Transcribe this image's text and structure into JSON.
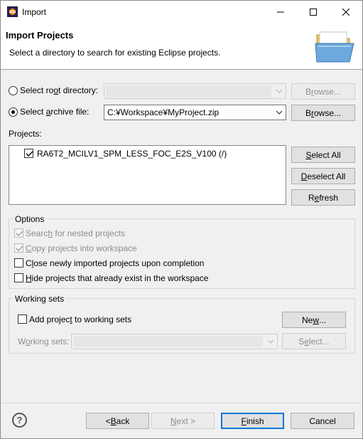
{
  "window": {
    "title": "Import"
  },
  "header": {
    "title": "Import Projects",
    "description": "Select a directory to search for existing Eclipse projects."
  },
  "source": {
    "root_dir": {
      "label_pre": "Select ro",
      "label_u": "o",
      "label_post": "t directory:",
      "value": "",
      "browse_pre": "B",
      "browse_u": "r",
      "browse_post": "owse...",
      "selected": false
    },
    "archive": {
      "label_pre": "Select ",
      "label_u": "a",
      "label_post": "rchive file:",
      "value": "C:¥Workspace¥MyProject.zip",
      "browse_pre": "B",
      "browse_u": "r",
      "browse_post": "owse...",
      "selected": true
    }
  },
  "projects": {
    "label": "Projects:",
    "items": [
      {
        "name": "RA6T2_MCILV1_SPM_LESS_FOC_E2S_V100 (/)",
        "checked": true
      }
    ],
    "select_all": {
      "u": "S",
      "post": "elect All"
    },
    "deselect_all": {
      "u": "D",
      "post": "eselect All"
    },
    "refresh": {
      "pre": "R",
      "u": "e",
      "post": "fresh"
    }
  },
  "options": {
    "title": "Options",
    "search_nested": {
      "pre": "Searc",
      "u": "h",
      "post": " for nested projects",
      "checked": true,
      "enabled": false
    },
    "copy_projects": {
      "pre": "",
      "u": "C",
      "post": "opy projects into workspace",
      "checked": true,
      "enabled": false
    },
    "close_imported": {
      "pre": "C",
      "u": "l",
      "post": "ose newly imported projects upon completion",
      "checked": false,
      "enabled": true
    },
    "hide_existing": {
      "pre": "",
      "u": "H",
      "post": "ide projects that already exist in the workspace",
      "checked": false,
      "enabled": true
    }
  },
  "working_sets": {
    "title": "Working sets",
    "add_to": {
      "pre": "Add projec",
      "u": "t",
      "post": " to working sets",
      "checked": false
    },
    "new_button": {
      "pre": "Ne",
      "u": "w",
      "post": "..."
    },
    "sets_label": {
      "pre": "W",
      "u": "o",
      "post": "rking sets:"
    },
    "sets_value": "",
    "select_button": {
      "pre": "S",
      "u": "e",
      "post": "lect..."
    }
  },
  "footer": {
    "help": "?",
    "back": {
      "pre": "< ",
      "u": "B",
      "post": "ack"
    },
    "next": {
      "pre": "",
      "u": "N",
      "post": "ext >"
    },
    "finish": {
      "pre": "",
      "u": "F",
      "post": "inish"
    },
    "cancel": "Cancel"
  }
}
